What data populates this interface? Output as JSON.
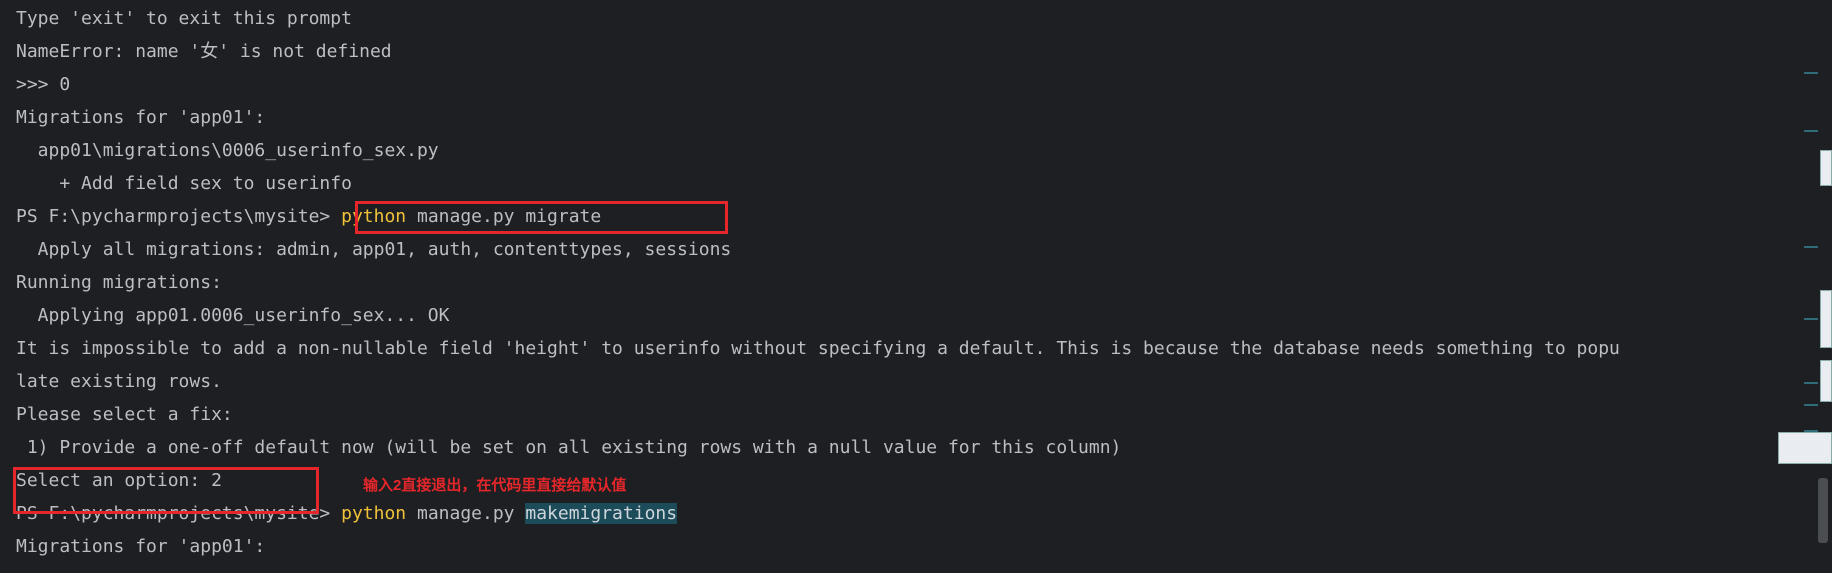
{
  "terminal": {
    "lines": [
      {
        "text": "Type 'exit' to exit this prompt"
      },
      {
        "text": "NameError: name '女' is not defined"
      },
      {
        "text": ">>> 0"
      },
      {
        "text": "Migrations for 'app01':"
      },
      {
        "text": "  app01\\migrations\\0006_userinfo_sex.py"
      },
      {
        "text": "    + Add field sex to userinfo"
      },
      {
        "prompt": "PS F:\\pycharmprojects\\mysite> ",
        "cmd": "python",
        "args": " manage.py migrate"
      },
      {
        "text": "  Apply all migrations: admin, app01, auth, contenttypes, sessions"
      },
      {
        "text": "Running migrations:"
      },
      {
        "text": "  Applying app01.0006_userinfo_sex... OK"
      },
      {
        "text": "It is impossible to add a non-nullable field 'height' to userinfo without specifying a default. This is because the database needs something to popu"
      },
      {
        "text": "late existing rows."
      },
      {
        "text": "Please select a fix:"
      },
      {
        "text": " 1) Provide a one-off default now (will be set on all existing rows with a null value for this column)"
      },
      {
        "text": "Select an option: 2"
      },
      {
        "prompt": "PS F:\\pycharmprojects\\mysite> ",
        "cmd": "python",
        "args": " manage.py ",
        "highlight": "makemigrations"
      },
      {
        "text": "Migrations for 'app01':"
      }
    ],
    "annotation": "输入2直接退出，在代码里直接给默认值"
  },
  "colors": {
    "background": "#1e1f22",
    "text": "#bcbec4",
    "keyword": "#f0c23a",
    "annotation_red": "#e5262a",
    "selection": "#1c4b5a"
  }
}
